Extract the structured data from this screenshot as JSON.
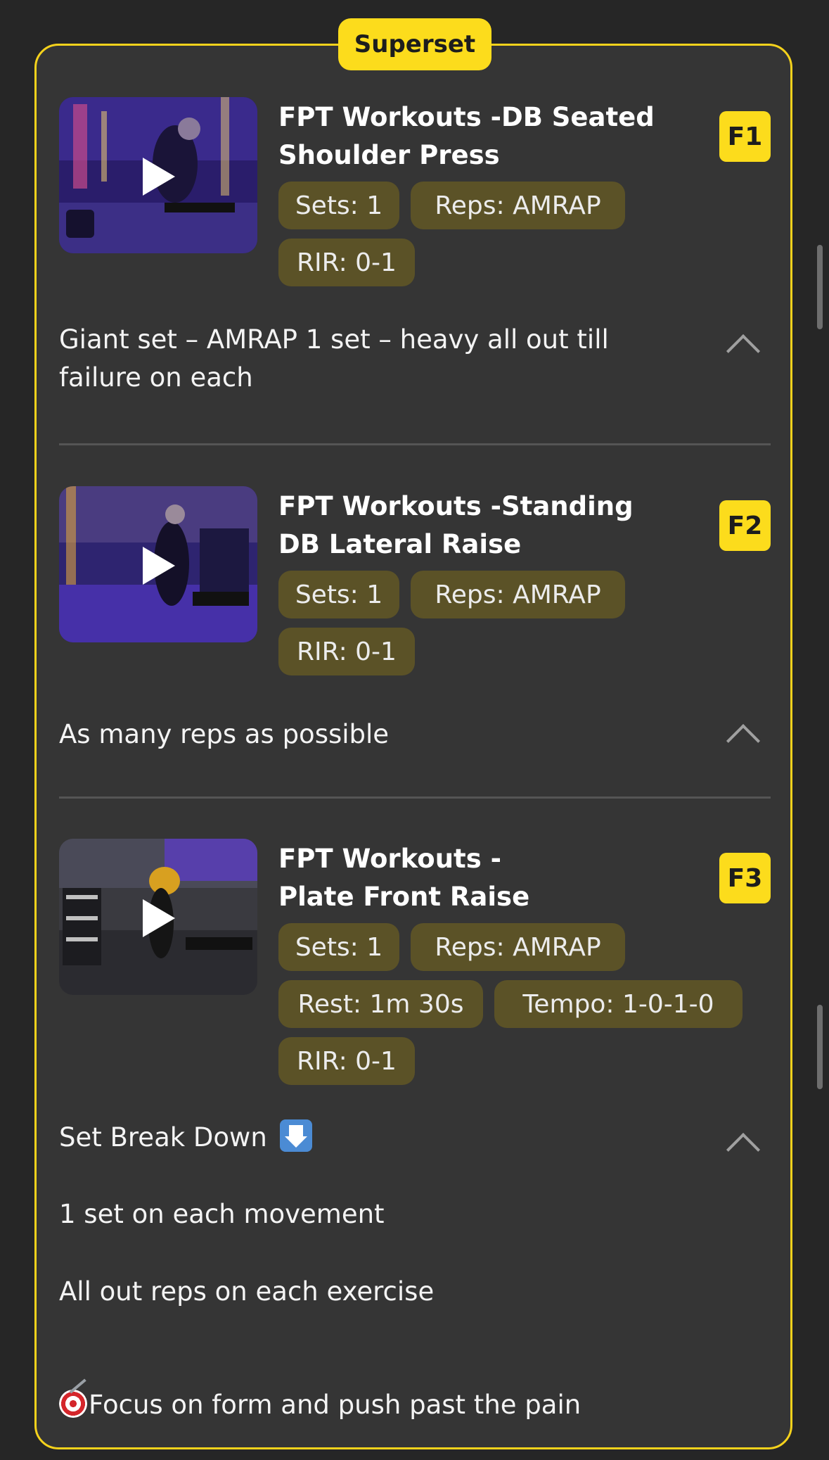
{
  "superset": {
    "label": "Superset"
  },
  "exercises": [
    {
      "code": "F1",
      "title": "FPT Workouts -DB Seated Shoulder Press",
      "chips": [
        "Sets: 1",
        "Reps: AMRAP",
        "RIR: 0-1"
      ],
      "note": "Giant set – AMRAP  1 set – heavy all out till failure on each"
    },
    {
      "code": "F2",
      "title": "FPT Workouts -Standing DB Lateral Raise",
      "chips": [
        "Sets: 1",
        "Reps: AMRAP",
        "RIR: 0-1"
      ],
      "note": "As many reps as possible"
    },
    {
      "code": "F3",
      "title": "FPT Workouts -Plate Front Raise",
      "chips": [
        "Sets: 1",
        "Reps: AMRAP",
        "Rest: 1m 30s",
        "Tempo: 1-0-1-0",
        "RIR: 0-1"
      ],
      "note_title": "Set Break Down",
      "note_lines": [
        "1 set on each movement",
        "All out reps  on each exercise",
        "Focus on form and push past the pain"
      ]
    }
  ],
  "icons": {
    "play": "play-icon",
    "collapse": "chevron-up-icon",
    "down_arrow_emoji": "down-arrow-emoji-icon",
    "target_emoji": "direct-hit-emoji-icon"
  },
  "colors": {
    "accent": "#fcdc1c",
    "card_background": "#353535",
    "chip_background": "#5b5227"
  }
}
